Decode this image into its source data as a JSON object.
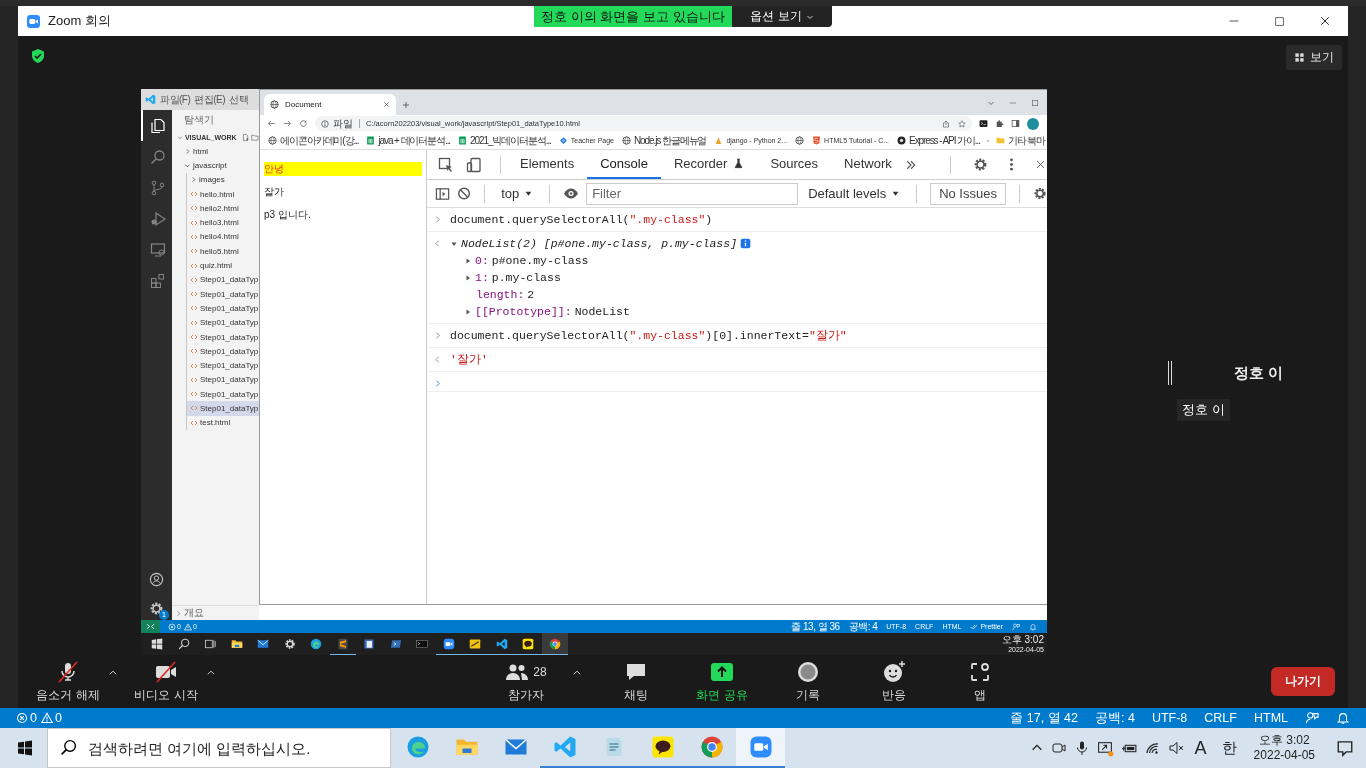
{
  "window": {
    "title": "Zoom 회의"
  },
  "share_banner": {
    "text": "정호 이의 화면을 보고 있습니다",
    "options": "옵션 보기"
  },
  "view_button": {
    "label": "보기"
  },
  "shared_screen": {
    "vscode": {
      "menu": [
        "파일(F)",
        "편집(E)",
        "선택"
      ],
      "activity": [
        {
          "kind": "explorer",
          "selected": true
        },
        {
          "kind": "search",
          "selected": false
        },
        {
          "kind": "source-control",
          "selected": false
        },
        {
          "kind": "run",
          "selected": false
        },
        {
          "kind": "remote",
          "selected": false
        },
        {
          "kind": "extensions",
          "selected": false
        }
      ],
      "settings_badge": "1",
      "explorer_title": "탐색기",
      "workspace": "VISUAL_WORK",
      "tree": [
        {
          "kind": "folder",
          "label": "html",
          "expanded": false,
          "selected": false
        },
        {
          "kind": "folder",
          "label": "javascript",
          "expanded": true,
          "selected": false,
          "children": [
            {
              "kind": "folder",
              "label": "images",
              "expanded": false,
              "selected": false
            },
            {
              "kind": "file",
              "label": "hello.html",
              "selected": false
            },
            {
              "kind": "file",
              "label": "hello2.html",
              "selected": false
            },
            {
              "kind": "file",
              "label": "hello3.html",
              "selected": false
            },
            {
              "kind": "file",
              "label": "hello4.html",
              "selected": false
            },
            {
              "kind": "file",
              "label": "hello5.html",
              "selected": false
            },
            {
              "kind": "file",
              "label": "quiz.html",
              "selected": false
            },
            {
              "kind": "file",
              "label": "Step01_dataTyp",
              "selected": false
            },
            {
              "kind": "file",
              "label": "Step01_dataTyp",
              "selected": false
            },
            {
              "kind": "file",
              "label": "Step01_dataTyp",
              "selected": false
            },
            {
              "kind": "file",
              "label": "Step01_dataTyp",
              "selected": false
            },
            {
              "kind": "file",
              "label": "Step01_dataTyp",
              "selected": false
            },
            {
              "kind": "file",
              "label": "Step01_dataTyp",
              "selected": false
            },
            {
              "kind": "file",
              "label": "Step01_dataTyp",
              "selected": false
            },
            {
              "kind": "file",
              "label": "Step01_dataTyp",
              "selected": false
            },
            {
              "kind": "file",
              "label": "Step01_dataTyp",
              "selected": false
            },
            {
              "kind": "file",
              "label": "Step01_dataTyp",
              "selected": true
            },
            {
              "kind": "file",
              "label": "test.html",
              "selected": false
            }
          ]
        }
      ],
      "outline": "개요",
      "status_bar": {
        "errors": "0",
        "warnings": "0",
        "items": [
          {
            "kind": "text",
            "text": "줄 13, 열 36"
          },
          {
            "kind": "text",
            "text": "공백: 4"
          },
          {
            "kind": "text",
            "text": "UTF-8"
          },
          {
            "kind": "text",
            "text": "CRLF"
          },
          {
            "kind": "text",
            "text": "HTML"
          },
          {
            "kind": "prettier",
            "text": "Prettier"
          }
        ]
      }
    },
    "browser": {
      "tabs": [
        {
          "title": "Document",
          "selected": true
        }
      ],
      "address": {
        "scheme": "파일",
        "url": "C:/acorn202203/visual_work/javascript/Step01_dataType10.html"
      },
      "bookmarks": [
        {
          "kind": "globe",
          "title": "에이콘아카데미(강..."
        },
        {
          "kind": "sheet",
          "title": "java + 데이터분석..."
        },
        {
          "kind": "sheet",
          "title": "2021_빅데이터분석..."
        },
        {
          "kind": "diamond",
          "title": "Teacher Page"
        },
        {
          "kind": "globe",
          "title": "Node.js 한글메뉴얼"
        },
        {
          "kind": "python",
          "title": "django - Python 2..."
        },
        {
          "kind": "globe"
        },
        {
          "kind": "html5",
          "title": "HTML5 Tutorial - C..."
        },
        {
          "kind": "express",
          "title": "Express - API 가이..."
        }
      ],
      "other_bookmarks": "기타 북마",
      "page": [
        {
          "text": "안녕",
          "highlighted": true
        },
        {
          "text": "잘가",
          "highlighted": false
        },
        {
          "text": "p3 입니다.",
          "highlighted": false
        }
      ],
      "devtools": {
        "tabs": [
          {
            "label": "Elements",
            "selected": false
          },
          {
            "label": "Console",
            "selected": true
          },
          {
            "label": "Recorder",
            "selected": false,
            "experimental": true
          },
          {
            "label": "Sources",
            "selected": false
          },
          {
            "label": "Network",
            "selected": false
          }
        ],
        "context": "top",
        "filter": {
          "placeholder": "Filter"
        },
        "levels": "Default levels",
        "issues": "No Issues",
        "console": [
          {
            "kind": "input",
            "parts": [
              {
                "kind": "code",
                "text": "document.querySelectorAll("
              },
              {
                "kind": "string",
                "text": "\".my-class\""
              },
              {
                "kind": "code",
                "text": ")"
              }
            ]
          },
          {
            "kind": "object",
            "summary": "NodeList(2) [p#one.my-class, p.my-class]",
            "expanded": true,
            "info": true,
            "properties": [
              {
                "key": "0:",
                "value": "p#one.my-class",
                "expandable": true,
                "expanded": false
              },
              {
                "key": "1:",
                "value": "p.my-class",
                "expandable": true,
                "expanded": false
              },
              {
                "key": "length:",
                "value": "2",
                "expandable": false
              },
              {
                "key": "[[Prototype]]:",
                "value": "NodeList",
                "expandable": true,
                "expanded": false
              }
            ]
          },
          {
            "kind": "input",
            "parts": [
              {
                "kind": "code",
                "text": "document.querySelectorAll("
              },
              {
                "kind": "string",
                "text": "\".my-class\""
              },
              {
                "kind": "code",
                "text": ")[0].innerText="
              },
              {
                "kind": "string",
                "text": "\"잘가\""
              }
            ]
          },
          {
            "kind": "result",
            "text": "'잘가'"
          },
          {
            "kind": "prompt"
          }
        ]
      }
    },
    "taskbar": {
      "apps": [
        {
          "kind": "windows",
          "running": false,
          "active": false
        },
        {
          "kind": "search",
          "running": false,
          "active": false
        },
        {
          "kind": "taskview",
          "running": false,
          "active": false
        },
        {
          "kind": "explorer",
          "running": false,
          "active": false
        },
        {
          "kind": "mail",
          "running": false,
          "active": false
        },
        {
          "kind": "settings",
          "running": false,
          "active": false
        },
        {
          "kind": "edge",
          "running": false,
          "active": false
        },
        {
          "kind": "sublime",
          "running": true,
          "active": false
        },
        {
          "kind": "document",
          "running": false,
          "active": false
        },
        {
          "kind": "powershell",
          "running": false,
          "active": false
        },
        {
          "kind": "terminal",
          "running": false,
          "active": false
        },
        {
          "kind": "zoom",
          "running": true,
          "active": false
        },
        {
          "kind": "ftp",
          "running": true,
          "active": false
        },
        {
          "kind": "vscode",
          "running": true,
          "active": false
        },
        {
          "kind": "kakao",
          "running": true,
          "active": false
        },
        {
          "kind": "chrome",
          "running": true,
          "active": true
        }
      ],
      "time": "오후 3:02",
      "date": "2022-04-05"
    }
  },
  "participant": {
    "name": "정호 이",
    "label": "정호 이"
  },
  "toolbar": {
    "left": [
      {
        "kind": "mic",
        "label": "음소거 해제",
        "muted": true,
        "menu": true
      },
      {
        "kind": "video",
        "label": "비디오 시작",
        "muted": true,
        "menu": true
      }
    ],
    "center": [
      {
        "kind": "participants",
        "label": "참가자",
        "count": "28",
        "menu": true
      },
      {
        "kind": "chat",
        "label": "채팅",
        "menu": false
      },
      {
        "kind": "share",
        "label": "화면 공유",
        "menu": false
      },
      {
        "kind": "record",
        "label": "기록",
        "menu": false
      },
      {
        "kind": "reactions",
        "label": "반응",
        "menu": false
      },
      {
        "kind": "apps",
        "label": "앱",
        "menu": false
      }
    ],
    "leave": "나가기"
  },
  "desktop": {
    "status_bar": {
      "errors": "0",
      "warnings": "0",
      "items": [
        "줄 17, 열 42",
        "공백: 4",
        "UTF-8",
        "CRLF",
        "HTML"
      ]
    },
    "taskbar": {
      "search": {
        "placeholder": "검색하려면 여기에 입력하십시오."
      },
      "apps": [
        {
          "kind": "edge",
          "running": false,
          "active": false
        },
        {
          "kind": "explorer",
          "running": false,
          "active": false
        },
        {
          "kind": "mail",
          "running": false,
          "active": false
        },
        {
          "kind": "vscode",
          "running": true,
          "active": false
        },
        {
          "kind": "notepad",
          "running": true,
          "active": false
        },
        {
          "kind": "kakao",
          "running": true,
          "active": false
        },
        {
          "kind": "chrome",
          "running": true,
          "active": false
        },
        {
          "kind": "zoom",
          "running": true,
          "active": true
        }
      ],
      "input_mode": "A",
      "ime": "한",
      "time": "오후 3:02",
      "date": "2022-04-05"
    }
  }
}
